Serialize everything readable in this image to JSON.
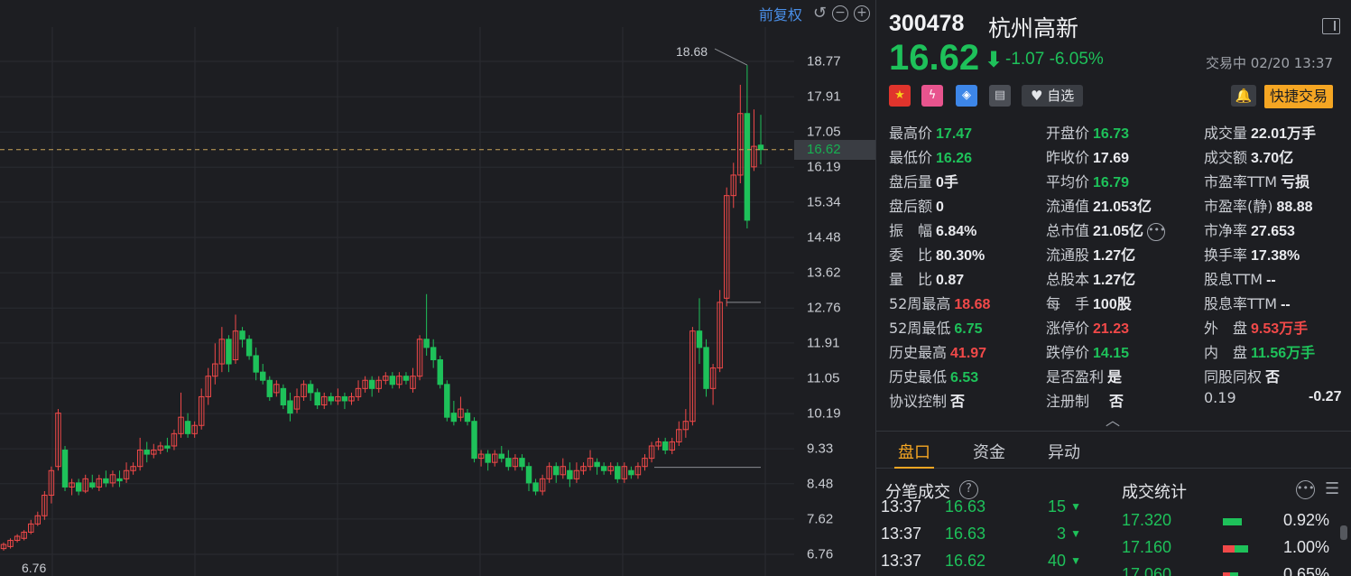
{
  "chart": {
    "adjust_label": "前复权",
    "price_ticks": [
      "18.77",
      "17.91",
      "17.05",
      "16.19",
      "15.34",
      "14.48",
      "13.62",
      "12.76",
      "11.91",
      "11.05",
      "10.19",
      "9.33",
      "8.48",
      "7.62",
      "6.76"
    ],
    "current_price_label": "16.62",
    "high_marker": "18.68",
    "low_marker": "6.76",
    "colors": {
      "up": "#f14949",
      "down": "#1ec15a",
      "grid": "#2a2c31",
      "dash": "#c9a45a"
    }
  },
  "chart_data": {
    "type": "candlestick",
    "ylim": [
      6.76,
      18.77
    ],
    "candles": [
      [
        6.9,
        7.0,
        6.85,
        7.05
      ],
      [
        6.95,
        7.1,
        6.9,
        7.15
      ],
      [
        7.1,
        7.2,
        7.05,
        7.25
      ],
      [
        7.15,
        7.3,
        7.1,
        7.35
      ],
      [
        7.3,
        7.5,
        7.25,
        7.6
      ],
      [
        7.5,
        7.7,
        7.45,
        7.8
      ],
      [
        7.7,
        8.2,
        7.6,
        8.3
      ],
      [
        8.2,
        8.8,
        8.0,
        8.9
      ],
      [
        8.9,
        10.2,
        8.8,
        10.3
      ],
      [
        9.3,
        8.4,
        8.3,
        9.4
      ],
      [
        8.4,
        8.5,
        8.2,
        8.6
      ],
      [
        8.5,
        8.3,
        8.2,
        8.6
      ],
      [
        8.3,
        8.6,
        8.25,
        8.7
      ],
      [
        8.5,
        8.4,
        8.35,
        8.7
      ],
      [
        8.4,
        8.6,
        8.3,
        8.7
      ],
      [
        8.6,
        8.5,
        8.4,
        8.8
      ],
      [
        8.5,
        8.7,
        8.4,
        8.8
      ],
      [
        8.6,
        8.55,
        8.4,
        8.8
      ],
      [
        8.6,
        8.8,
        8.5,
        9.0
      ],
      [
        8.8,
        8.9,
        8.7,
        9.0
      ],
      [
        8.9,
        9.3,
        8.8,
        9.6
      ],
      [
        9.3,
        9.2,
        9.0,
        9.5
      ],
      [
        9.2,
        9.3,
        9.1,
        9.45
      ],
      [
        9.3,
        9.4,
        9.2,
        9.5
      ],
      [
        9.4,
        9.35,
        9.25,
        9.6
      ],
      [
        9.4,
        9.7,
        9.3,
        9.8
      ],
      [
        9.7,
        10.1,
        9.6,
        10.7
      ],
      [
        10.0,
        9.7,
        9.6,
        10.2
      ],
      [
        9.7,
        9.9,
        9.6,
        10.0
      ],
      [
        9.9,
        10.6,
        9.8,
        10.8
      ],
      [
        10.6,
        11.1,
        10.4,
        11.3
      ],
      [
        11.1,
        11.4,
        10.9,
        11.9
      ],
      [
        11.4,
        12.0,
        11.2,
        12.3
      ],
      [
        12.0,
        11.4,
        11.2,
        12.1
      ],
      [
        11.5,
        12.2,
        11.4,
        12.6
      ],
      [
        12.2,
        12.0,
        11.8,
        12.3
      ],
      [
        12.0,
        11.6,
        11.5,
        12.1
      ],
      [
        11.6,
        11.2,
        11.0,
        11.8
      ],
      [
        11.2,
        11.0,
        10.9,
        11.4
      ],
      [
        11.0,
        10.6,
        10.5,
        11.1
      ],
      [
        10.7,
        10.9,
        10.6,
        11.0
      ],
      [
        10.8,
        10.4,
        10.3,
        10.9
      ],
      [
        10.5,
        10.2,
        10.0,
        10.7
      ],
      [
        10.3,
        10.6,
        10.2,
        10.8
      ],
      [
        10.6,
        10.9,
        10.5,
        11.0
      ],
      [
        10.9,
        10.7,
        10.5,
        11.0
      ],
      [
        10.7,
        10.4,
        10.3,
        10.8
      ],
      [
        10.4,
        10.6,
        10.3,
        10.7
      ],
      [
        10.6,
        10.5,
        10.4,
        10.7
      ],
      [
        10.5,
        10.6,
        10.4,
        10.8
      ],
      [
        10.6,
        10.5,
        10.3,
        10.7
      ],
      [
        10.5,
        10.6,
        10.4,
        10.7
      ],
      [
        10.6,
        10.8,
        10.5,
        11.0
      ],
      [
        10.8,
        11.0,
        10.7,
        11.1
      ],
      [
        11.0,
        10.8,
        10.6,
        11.1
      ],
      [
        10.8,
        11.0,
        10.7,
        11.1
      ],
      [
        11.0,
        11.1,
        10.9,
        11.2
      ],
      [
        11.1,
        10.9,
        10.8,
        11.2
      ],
      [
        10.9,
        11.1,
        10.8,
        11.2
      ],
      [
        11.1,
        11.0,
        10.9,
        11.2
      ],
      [
        10.8,
        11.1,
        10.7,
        11.3
      ],
      [
        11.1,
        12.0,
        11.0,
        12.1
      ],
      [
        12.0,
        11.8,
        11.6,
        13.1
      ],
      [
        11.8,
        11.5,
        11.3,
        12.0
      ],
      [
        11.5,
        10.9,
        10.8,
        11.6
      ],
      [
        10.9,
        10.1,
        10.0,
        11.0
      ],
      [
        10.2,
        10.0,
        9.9,
        10.5
      ],
      [
        10.1,
        10.3,
        10.0,
        10.6
      ],
      [
        10.2,
        10.0,
        9.9,
        10.3
      ],
      [
        10.0,
        9.1,
        9.0,
        10.1
      ],
      [
        9.1,
        9.2,
        8.9,
        9.3
      ],
      [
        9.2,
        9.0,
        8.8,
        9.3
      ],
      [
        9.0,
        9.2,
        8.9,
        9.3
      ],
      [
        9.2,
        9.1,
        9.0,
        9.4
      ],
      [
        9.1,
        8.9,
        8.8,
        9.3
      ],
      [
        8.9,
        9.1,
        8.8,
        9.2
      ],
      [
        9.1,
        8.9,
        8.8,
        9.2
      ],
      [
        8.9,
        8.5,
        8.3,
        9.0
      ],
      [
        8.5,
        8.3,
        8.2,
        8.6
      ],
      [
        8.3,
        8.6,
        8.2,
        8.7
      ],
      [
        8.6,
        8.9,
        8.5,
        9.0
      ],
      [
        8.9,
        8.7,
        8.5,
        9.0
      ],
      [
        8.7,
        8.9,
        8.6,
        9.1
      ],
      [
        8.8,
        8.6,
        8.4,
        9.0
      ],
      [
        8.6,
        8.8,
        8.5,
        9.0
      ],
      [
        8.8,
        8.9,
        8.7,
        9.0
      ],
      [
        8.9,
        9.1,
        8.8,
        9.3
      ],
      [
        9.0,
        8.9,
        8.7,
        9.1
      ],
      [
        8.9,
        8.8,
        8.7,
        9.0
      ],
      [
        8.8,
        8.9,
        8.7,
        9.0
      ],
      [
        8.9,
        8.6,
        8.5,
        9.0
      ],
      [
        8.6,
        8.9,
        8.5,
        9.0
      ],
      [
        8.8,
        8.7,
        8.6,
        8.9
      ],
      [
        8.7,
        8.9,
        8.6,
        9.0
      ],
      [
        8.9,
        9.1,
        8.8,
        9.2
      ],
      [
        9.1,
        9.4,
        9.0,
        9.5
      ],
      [
        9.4,
        9.5,
        9.3,
        9.6
      ],
      [
        9.5,
        9.3,
        9.2,
        9.6
      ],
      [
        9.3,
        9.5,
        9.2,
        9.6
      ],
      [
        9.5,
        9.8,
        9.4,
        10.0
      ],
      [
        9.8,
        10.0,
        9.6,
        10.3
      ],
      [
        10.0,
        12.2,
        9.9,
        12.3
      ],
      [
        12.2,
        11.8,
        11.4,
        13.0
      ],
      [
        11.8,
        10.8,
        10.6,
        12.0
      ],
      [
        10.8,
        11.3,
        10.4,
        11.4
      ],
      [
        11.3,
        12.9,
        11.2,
        13.2
      ],
      [
        13.0,
        15.5,
        12.8,
        15.7
      ],
      [
        15.5,
        16.0,
        15.2,
        16.3
      ],
      [
        16.0,
        17.5,
        15.8,
        18.2
      ],
      [
        17.5,
        14.9,
        14.7,
        18.68
      ],
      [
        16.2,
        16.7,
        16.1,
        17.6
      ],
      [
        16.73,
        16.62,
        16.26,
        17.47
      ]
    ]
  },
  "header": {
    "code": "300478",
    "name": "杭州高新",
    "price": "16.62",
    "change": "-1.07",
    "change_pct": "-6.05%",
    "status_time": "交易中 02/20 13:37"
  },
  "tags": {
    "cn": "★",
    "flash": "ϟ",
    "label": "◈",
    "doc": "▤",
    "fav": "自选",
    "bell": "🔔",
    "trade": "快捷交易"
  },
  "stats": {
    "col1": [
      {
        "label": "最高价",
        "value": "17.47",
        "color": "green"
      },
      {
        "label": "最低价",
        "value": "16.26",
        "color": "green"
      },
      {
        "label": "盘后量",
        "value": "0手",
        "color": ""
      },
      {
        "label": "盘后额",
        "value": "0",
        "color": ""
      },
      {
        "label": "振　幅",
        "value": "6.84%",
        "color": ""
      },
      {
        "label": "委　比",
        "value": "80.30%",
        "color": ""
      },
      {
        "label": "量　比",
        "value": "0.87",
        "color": ""
      },
      {
        "label": "52周最高",
        "value": "18.68",
        "color": "red"
      },
      {
        "label": "52周最低",
        "value": "6.75",
        "color": "green"
      },
      {
        "label": "历史最高",
        "value": "41.97",
        "color": "red"
      },
      {
        "label": "历史最低",
        "value": "6.53",
        "color": "green"
      },
      {
        "label": "协议控制",
        "value": "否",
        "color": ""
      }
    ],
    "col2": [
      {
        "label": "开盘价",
        "value": "16.73",
        "color": "green"
      },
      {
        "label": "昨收价",
        "value": "17.69",
        "color": ""
      },
      {
        "label": "平均价",
        "value": "16.79",
        "color": "green"
      },
      {
        "label": "流通值",
        "value": "21.053亿",
        "color": ""
      },
      {
        "label": "总市值",
        "value": "21.05亿",
        "color": ""
      },
      {
        "label": "流通股",
        "value": "1.27亿",
        "color": ""
      },
      {
        "label": "总股本",
        "value": "1.27亿",
        "color": ""
      },
      {
        "label": "每　手",
        "value": "100股",
        "color": ""
      },
      {
        "label": "涨停价",
        "value": "21.23",
        "color": "red"
      },
      {
        "label": "跌停价",
        "value": "14.15",
        "color": "green"
      },
      {
        "label": "是否盈利",
        "value": "是",
        "color": ""
      },
      {
        "label": "注册制",
        "value": "否",
        "color": ""
      }
    ],
    "col3": [
      {
        "label": "成交量",
        "value": "22.01万手",
        "color": ""
      },
      {
        "label": "成交额",
        "value": "3.70亿",
        "color": ""
      },
      {
        "label": "市盈率TTM",
        "value": "亏损",
        "color": ""
      },
      {
        "label": "市盈率(静)",
        "value": "88.88",
        "color": ""
      },
      {
        "label": "市净率",
        "value": "27.653",
        "color": ""
      },
      {
        "label": "换手率",
        "value": "17.38%",
        "color": ""
      },
      {
        "label": "股息TTM",
        "value": "--",
        "color": ""
      },
      {
        "label": "股息率TTM",
        "value": "--",
        "color": ""
      },
      {
        "label": "外　盘",
        "value": "9.53万手",
        "color": "red"
      },
      {
        "label": "内　盘",
        "value": "11.56万手",
        "color": "green"
      },
      {
        "label": "同股同权",
        "value": "否",
        "color": ""
      },
      {
        "label": "0.19",
        "value": "-0.27",
        "color": ""
      }
    ]
  },
  "tabs": [
    "盘口",
    "资金",
    "异动"
  ],
  "ticks": {
    "title": "分笔成交",
    "help": "?",
    "rows": [
      {
        "time": "13:37",
        "price": "16.63",
        "vol": "15"
      },
      {
        "time": "13:37",
        "price": "16.63",
        "vol": "3"
      },
      {
        "time": "13:37",
        "price": "16.62",
        "vol": "40"
      }
    ]
  },
  "distribution": {
    "title": "成交统计",
    "rows": [
      {
        "price": "17.320",
        "pct": "0.92%",
        "red": 0.0,
        "green": 0.75
      },
      {
        "price": "17.160",
        "pct": "1.00%",
        "red": 0.45,
        "green": 0.55
      },
      {
        "price": "17.060",
        "pct": "0.65%",
        "red": 0.3,
        "green": 0.3
      }
    ]
  }
}
